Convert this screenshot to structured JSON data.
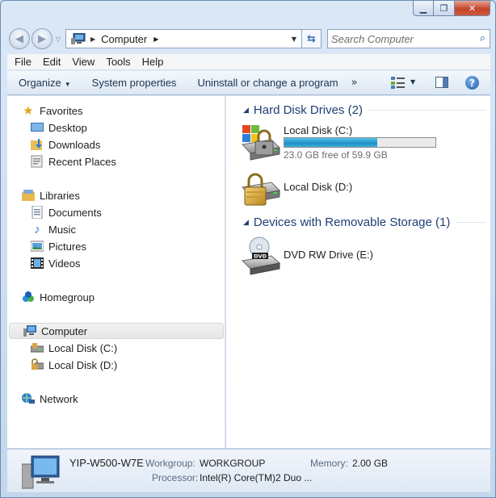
{
  "window": {
    "title": "Computer"
  },
  "address": {
    "crumb": "Computer"
  },
  "search": {
    "placeholder": "Search Computer"
  },
  "menu": [
    "File",
    "Edit",
    "View",
    "Tools",
    "Help"
  ],
  "toolbar": {
    "organize": "Organize",
    "system_properties": "System properties",
    "uninstall": "Uninstall or change a program",
    "more": "»"
  },
  "nav": {
    "favorites": "Favorites",
    "desktop": "Desktop",
    "downloads": "Downloads",
    "recent_places": "Recent Places",
    "libraries": "Libraries",
    "documents": "Documents",
    "music": "Music",
    "pictures": "Pictures",
    "videos": "Videos",
    "homegroup": "Homegroup",
    "computer": "Computer",
    "local_c": "Local Disk (C:)",
    "local_d": "Local Disk (D:)",
    "network": "Network"
  },
  "groups": {
    "hdd": {
      "title": "Hard Disk Drives (2)"
    },
    "removable": {
      "title": "Devices with Removable Storage (1)"
    }
  },
  "drives": {
    "c": {
      "name": "Local Disk (C:)",
      "free_text": "23.0 GB free of 59.9 GB",
      "used_fraction": 0.616
    },
    "d": {
      "name": "Local Disk (D:)"
    },
    "e": {
      "name": "DVD RW Drive (E:)",
      "badge": "DVD"
    }
  },
  "details": {
    "computer_name": "YIP-W500-W7E",
    "workgroup_label": "Workgroup:",
    "workgroup": "WORKGROUP",
    "memory_label": "Memory:",
    "memory": "2.00 GB",
    "processor_label": "Processor:",
    "processor": "Intel(R) Core(TM)2 Duo ..."
  },
  "colors": {
    "accent": "#1e3f73",
    "bar_fill": "#1c8fc6",
    "selection": "#e5e5e5"
  }
}
